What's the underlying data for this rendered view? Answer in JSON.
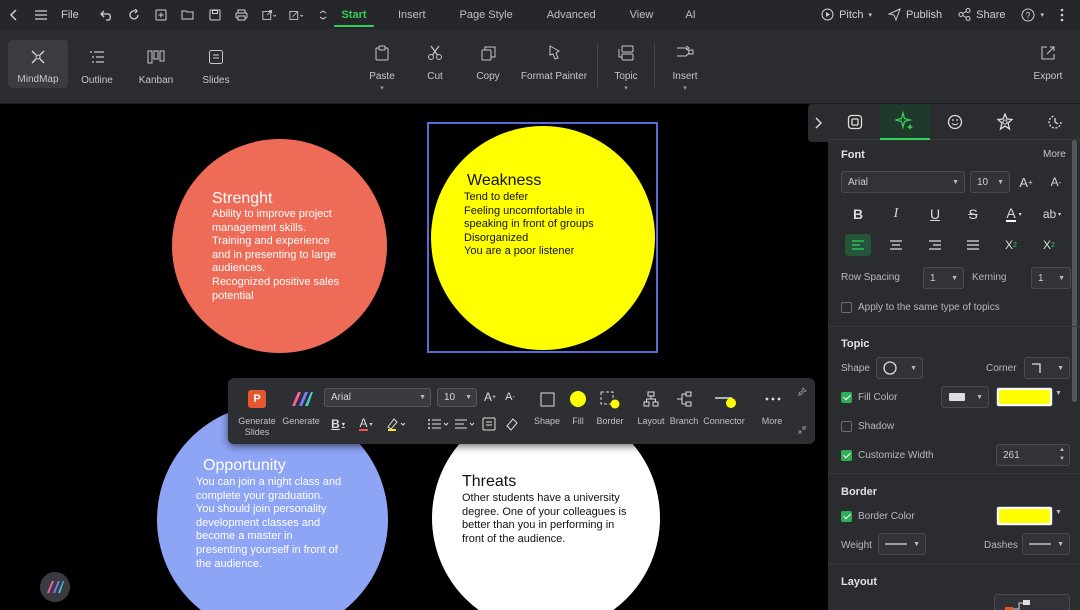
{
  "menubar": {
    "file": "File",
    "tabs": [
      "Start",
      "Insert",
      "Page Style",
      "Advanced",
      "View",
      "AI"
    ],
    "active_tab": "Start",
    "pitch": "Pitch",
    "publish": "Publish",
    "share": "Share"
  },
  "ribbon": {
    "views": [
      "MindMap",
      "Outline",
      "Kanban",
      "Slides"
    ],
    "paste": "Paste",
    "cut": "Cut",
    "copy": "Copy",
    "format_painter": "Format Painter",
    "topic": "Topic",
    "insert": "Insert",
    "export": "Export"
  },
  "canvas": {
    "strength": {
      "title": "Strenght",
      "lines": [
        "Ability to improve project",
        "management skills.",
        "Training and experience",
        "and in presenting to large",
        "audiences.",
        "Recognized positive sales",
        "potential"
      ]
    },
    "weakness": {
      "title": "Weakness",
      "lines": [
        "Tend to defer",
        "Feeling uncomfortable in",
        "speaking in front of groups",
        "Disorganized",
        "You are a poor listener"
      ]
    },
    "opportunity": {
      "title": "Opportunity",
      "lines": [
        "You can join a night class and",
        "complete your graduation.",
        "You should join personality",
        "development classes and",
        "become a master in",
        "presenting yourself in front of",
        "the audience."
      ]
    },
    "threats": {
      "title": "Threats",
      "lines": [
        "Other students have a university",
        "degree. One of your colleagues is",
        "better than you in performing in",
        "front of the audience."
      ]
    }
  },
  "float_toolbar": {
    "generate_slides": "Generate Slides",
    "generate": "Generate",
    "font": "Arial",
    "size": "10",
    "shape": "Shape",
    "fill": "Fill",
    "border": "Border",
    "layout": "Layout",
    "branch": "Branch",
    "connector": "Connector",
    "more": "More"
  },
  "panel": {
    "font_section": "Font",
    "more": "More",
    "font_family": "Arial",
    "font_size": "10",
    "row_spacing_label": "Row Spacing",
    "row_spacing": "1",
    "kerning_label": "Kerning",
    "kerning": "1",
    "apply_same": "Apply to the same type of topics",
    "topic_section": "Topic",
    "shape_label": "Shape",
    "corner_label": "Corner",
    "fill_color": "Fill Color",
    "shadow": "Shadow",
    "customize_width": "Customize Width",
    "width_value": "261",
    "border_section": "Border",
    "border_color": "Border Color",
    "weight_label": "Weight",
    "dashes_label": "Dashes",
    "layout_section": "Layout"
  },
  "colors": {
    "accent": "#34d058",
    "strength_fill": "#ee6b57",
    "weakness_fill": "#ffff00",
    "opportunity_fill": "#8ea4f4",
    "threats_fill": "#ffffff",
    "selection": "#5b6bd6"
  }
}
